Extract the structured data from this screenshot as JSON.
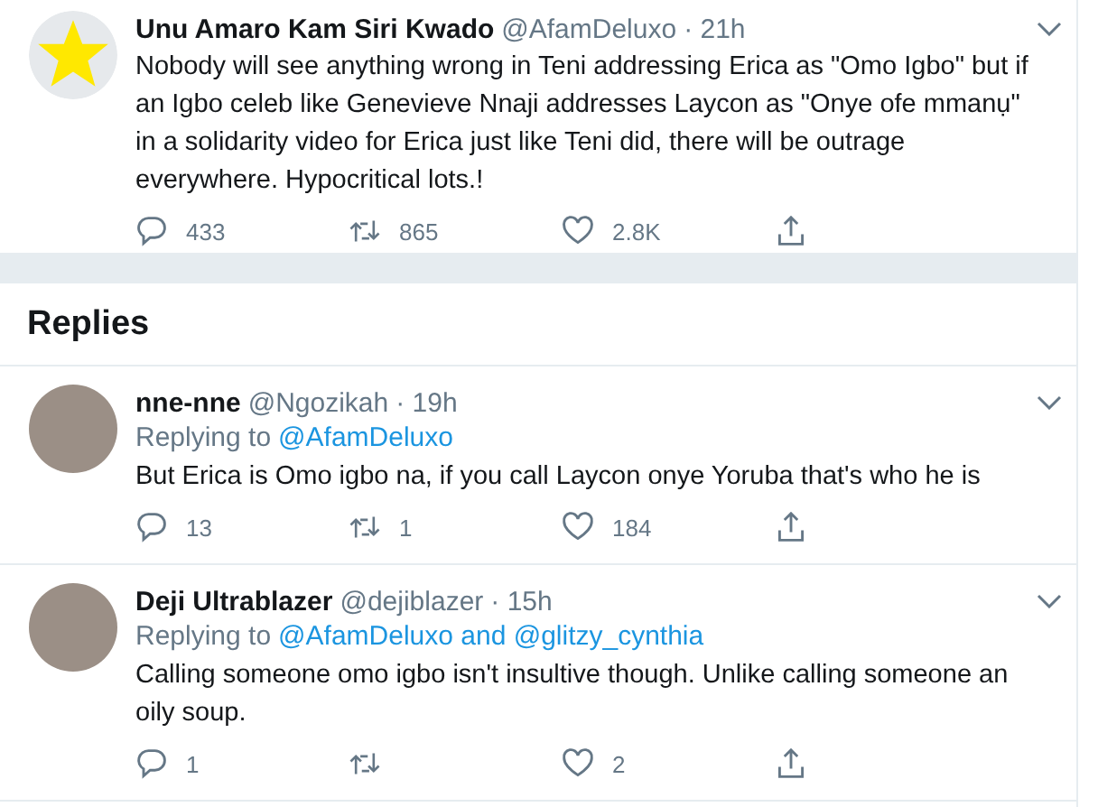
{
  "main_tweet": {
    "name": "Unu Amaro Kam Siri Kwado",
    "handle": "@AfamDeluxo",
    "time": "· 21h",
    "text": "Nobody will see anything wrong in Teni addressing Erica as \"Omo Igbo\" but if an Igbo celeb like Genevieve Nnaji addresses Laycon as \"Onye ofe mmanụ\" in a solidarity video for Erica just like Teni did, there will be outrage everywhere. Hypocritical lots.!",
    "actions": [
      {
        "kind": "reply",
        "count": "433"
      },
      {
        "kind": "retweet",
        "count": "865"
      },
      {
        "kind": "like",
        "count": "2.8K"
      },
      {
        "kind": "share"
      }
    ]
  },
  "replies_heading": "Replies",
  "replies": [
    {
      "name": "nne-nne",
      "handle": "@Ngozikah",
      "time": "· 19h",
      "replying_label": "Replying to",
      "replying_to": "@AfamDeluxo",
      "text": "But Erica is Omo igbo na, if you call Laycon onye Yoruba that's who he is",
      "actions": [
        {
          "kind": "reply",
          "count": "13"
        },
        {
          "kind": "retweet",
          "count": "1"
        },
        {
          "kind": "like",
          "count": "184"
        },
        {
          "kind": "share"
        }
      ]
    },
    {
      "name": "Deji Ultrablazer",
      "handle": "@dejiblazer",
      "time": "· 15h",
      "replying_label": "Replying to",
      "replying_to": "@AfamDeluxo and @glitzy_cynthia",
      "text": "Calling someone omo igbo isn't insultive though. Unlike calling someone an oily soup.",
      "actions": [
        {
          "kind": "reply",
          "count": "1"
        },
        {
          "kind": "retweet"
        },
        {
          "kind": "like",
          "count": "2"
        },
        {
          "kind": "share"
        }
      ]
    }
  ]
}
